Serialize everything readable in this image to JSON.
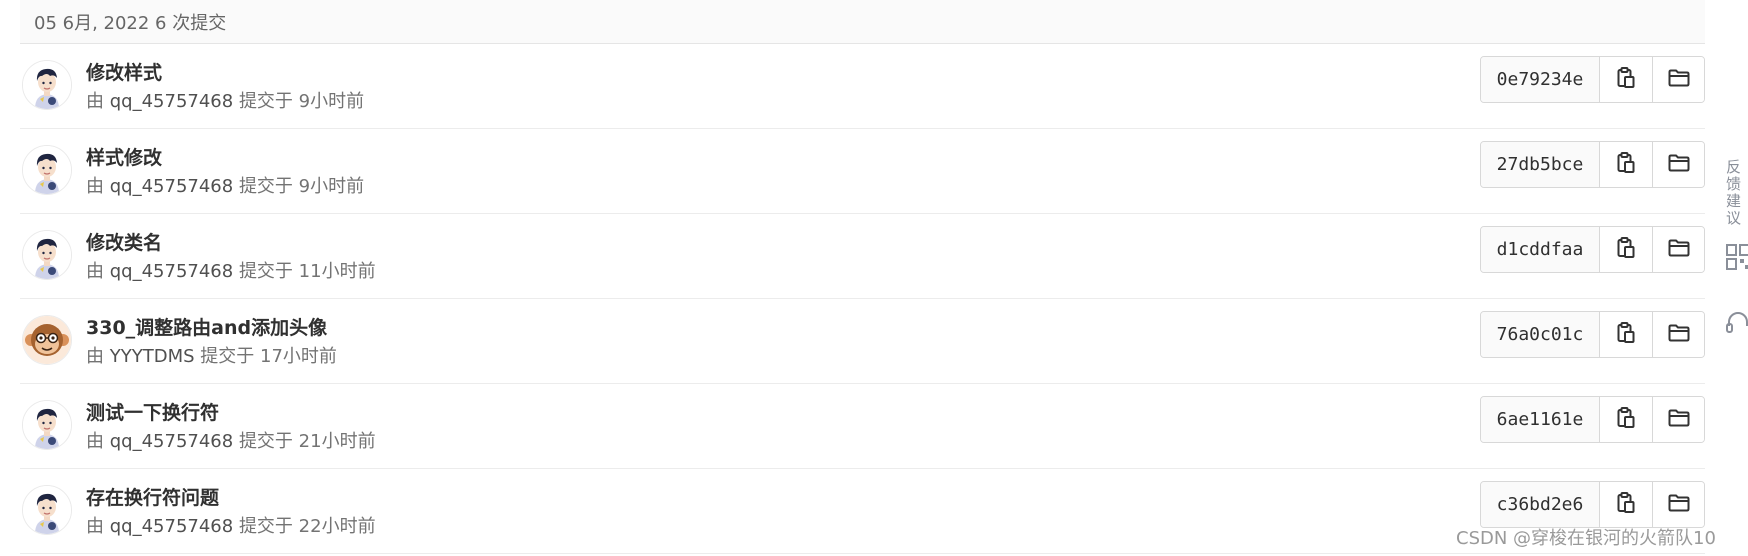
{
  "day_header": "05 6月, 2022 6 次提交",
  "commits": [
    {
      "title": "修改样式",
      "by": "由",
      "author": "qq_45757468",
      "action": "提交于",
      "time": "9小时前",
      "sha": "0e79234e",
      "avatar": "boy"
    },
    {
      "title": "样式修改",
      "by": "由",
      "author": "qq_45757468",
      "action": "提交于",
      "time": "9小时前",
      "sha": "27db5bce",
      "avatar": "boy"
    },
    {
      "title": "修改类名",
      "by": "由",
      "author": "qq_45757468",
      "action": "提交于",
      "time": "11小时前",
      "sha": "d1cddfaa",
      "avatar": "boy"
    },
    {
      "title": "330_调整路由and添加头像",
      "by": "由",
      "author": "YYYTDMS",
      "action": "提交于",
      "time": "17小时前",
      "sha": "76a0c01c",
      "avatar": "monkey"
    },
    {
      "title": "测试一下换行符",
      "by": "由",
      "author": "qq_45757468",
      "action": "提交于",
      "time": "21小时前",
      "sha": "6ae1161e",
      "avatar": "boy"
    },
    {
      "title": "存在换行符问题",
      "by": "由",
      "author": "qq_45757468",
      "action": "提交于",
      "time": "22小时前",
      "sha": "c36bd2e6",
      "avatar": "boy"
    }
  ],
  "icons": {
    "copy": "clipboard-icon",
    "browse": "folder-icon"
  },
  "side_tools": {
    "feedback_label": "反馈建议",
    "qr_icon": "qr-code-icon",
    "support_icon": "headset-icon"
  },
  "watermark": "CSDN @穿梭在银河的火箭队10"
}
